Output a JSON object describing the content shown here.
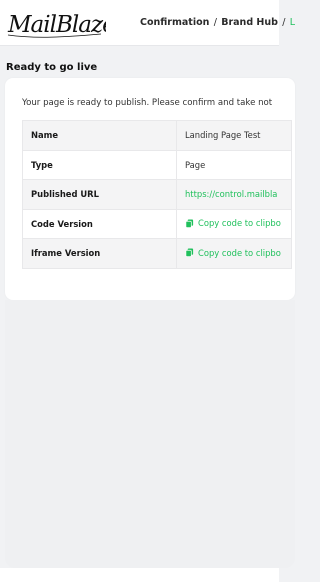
{
  "brand": {
    "logo_text": "MailBlaze"
  },
  "breadcrumb": {
    "items": [
      "Confirmation",
      "Brand Hub",
      "L"
    ],
    "separator": "/"
  },
  "page": {
    "title": "Ready to go live",
    "intro": "Your page is ready to publish. Please confirm and take not"
  },
  "details": {
    "rows": [
      {
        "label": "Name",
        "value": "Landing Page Test"
      },
      {
        "label": "Type",
        "value": "Page"
      },
      {
        "label": "Published URL",
        "value": "https://control.mailbla"
      },
      {
        "label": "Code Version",
        "value": "Copy code to clipbo"
      },
      {
        "label": "Iframe Version",
        "value": "Copy code to clipbo"
      }
    ]
  },
  "colors": {
    "accent": "#20c05c",
    "background": "#f1f2f4"
  }
}
